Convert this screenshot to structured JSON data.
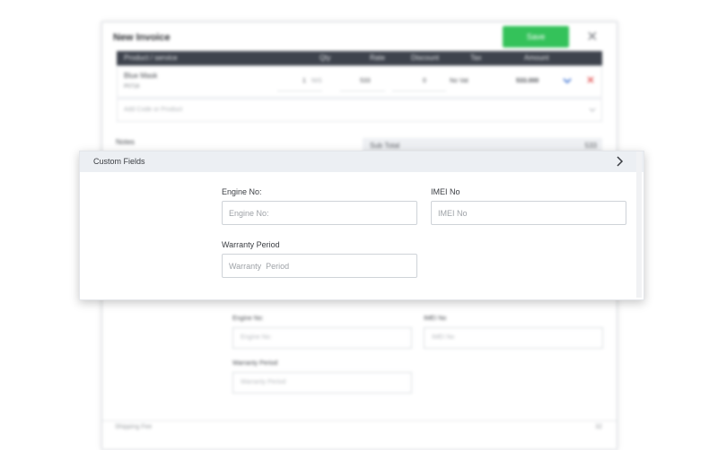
{
  "invoice": {
    "title": "New Invoice",
    "save_label": "Save",
    "close_glyph": "×",
    "columns": [
      "Product / service",
      "Qty",
      "Rate",
      "Discount",
      "Tax",
      "Amount"
    ],
    "row": {
      "product": "Blue Mask",
      "code": "P0716",
      "qty": "1",
      "unit": "NIS",
      "rate": "533",
      "discount": "0",
      "tax": "No Vat",
      "amount": "533.000"
    },
    "add_placeholder": "Add Code or Product",
    "notes_label": "Notes",
    "subtotal_label": "Sub Total",
    "subtotal_value": "533",
    "bg_fields": {
      "engine_label": "Engine No:",
      "engine_placeholder": "Engine No:",
      "imei_label": "IMEI No",
      "imei_placeholder": "IMEI No",
      "warranty_label": "Warranty Period",
      "warranty_placeholder": "Warranty  Period"
    },
    "bottom_label": "Shipping Fee",
    "bottom_value": "32"
  },
  "custom_fields": {
    "title": "Custom Fields",
    "engine_label": "Engine No:",
    "engine_placeholder": "Engine No:",
    "imei_label": "IMEI No",
    "imei_placeholder": "IMEI No",
    "warranty_label": "Warranty Period",
    "warranty_placeholder": "Warranty  Period"
  },
  "icons": {
    "expand": "chevron-right-icon",
    "close": "close-icon",
    "row_expand": "chevron-down-icon",
    "row_delete": "delete-icon"
  },
  "colors": {
    "save_button": "#34c25a",
    "table_header": "#3e434d",
    "panel_header": "#eceff3",
    "delete": "#e25555",
    "expand": "#3b6fd1"
  }
}
